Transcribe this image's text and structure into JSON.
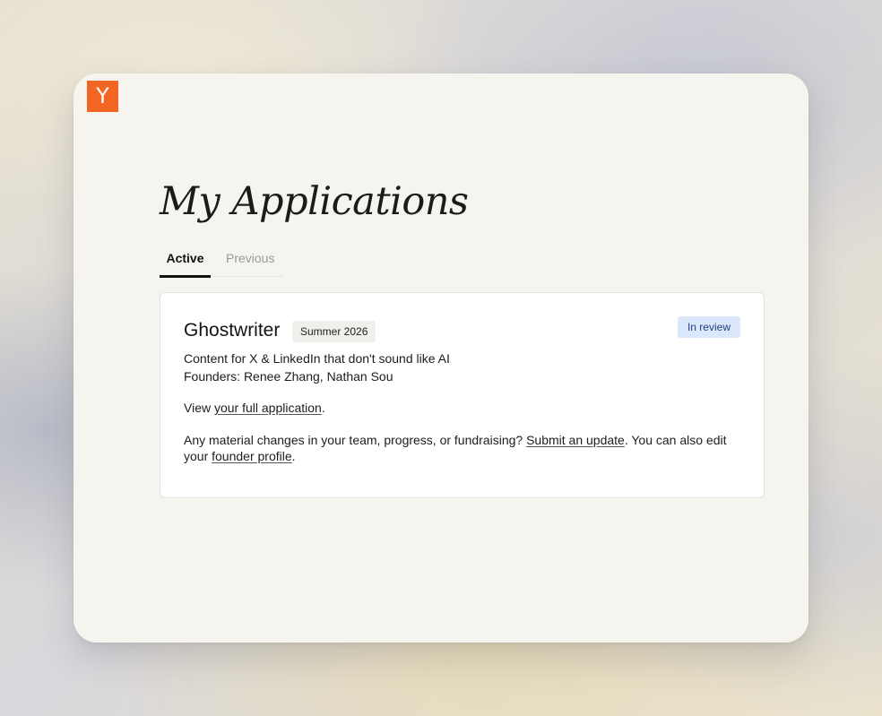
{
  "app": {
    "logo_letter": "Y",
    "title": "My Applications"
  },
  "tabs": [
    {
      "label": "Active",
      "active": true
    },
    {
      "label": "Previous",
      "active": false
    }
  ],
  "application": {
    "company": "Ghostwriter",
    "batch": "Summer 2026",
    "status": "In review",
    "tagline": "Content for X & LinkedIn that don't sound like AI",
    "founders_label": "Founders:",
    "founders": [
      "Renee Zhang,",
      "Nathan Sou"
    ],
    "view_prefix": "View ",
    "view_link": "your full application",
    "view_suffix": ".",
    "changes_prefix": "Any material changes in your team, progress, or fundraising? ",
    "update_link": "Submit an update",
    "changes_middle": ". You can also edit your ",
    "profile_link": "founder profile",
    "changes_suffix": "."
  },
  "colors": {
    "logo": "#f26522",
    "status_bg": "#dbe8fb",
    "status_text": "#23407a"
  }
}
